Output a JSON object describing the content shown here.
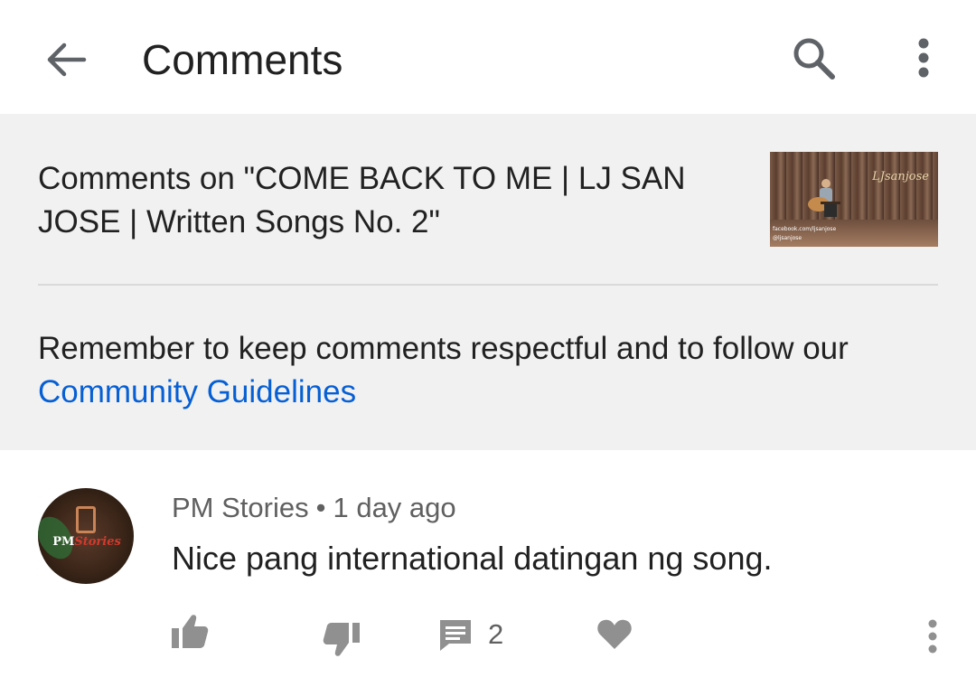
{
  "appbar": {
    "title": "Comments",
    "icons": {
      "back": "arrow-back-icon",
      "search": "search-icon",
      "more": "more-vert-icon"
    }
  },
  "header": {
    "video_title": "Comments on \"COME BACK TO ME | LJ SAN JOSE | Written Songs No. 2\"",
    "thumbnail": {
      "signature": "LJsanjose",
      "tags": [
        "facebook.com/ljsanjose",
        "@ljsanjose"
      ]
    },
    "guidelines_text": "Remember to keep comments respectful and to follow our ",
    "guidelines_link": "Community Guidelines"
  },
  "comment": {
    "author": "PM Stories",
    "separator": "•",
    "time": "1 day ago",
    "text": "Nice pang international datingan ng song.",
    "reply_count": "2",
    "avatar": {
      "text_main": "PM",
      "text_accent": "Stories"
    },
    "icons": [
      "thumb-up-icon",
      "thumb-down-icon",
      "reply-icon",
      "heart-icon",
      "more-vert-icon"
    ]
  },
  "colors": {
    "link": "#065fd4",
    "header_bg": "#f1f1f1",
    "icon": "#909090",
    "text_primary": "#212121",
    "text_secondary": "#606060"
  }
}
